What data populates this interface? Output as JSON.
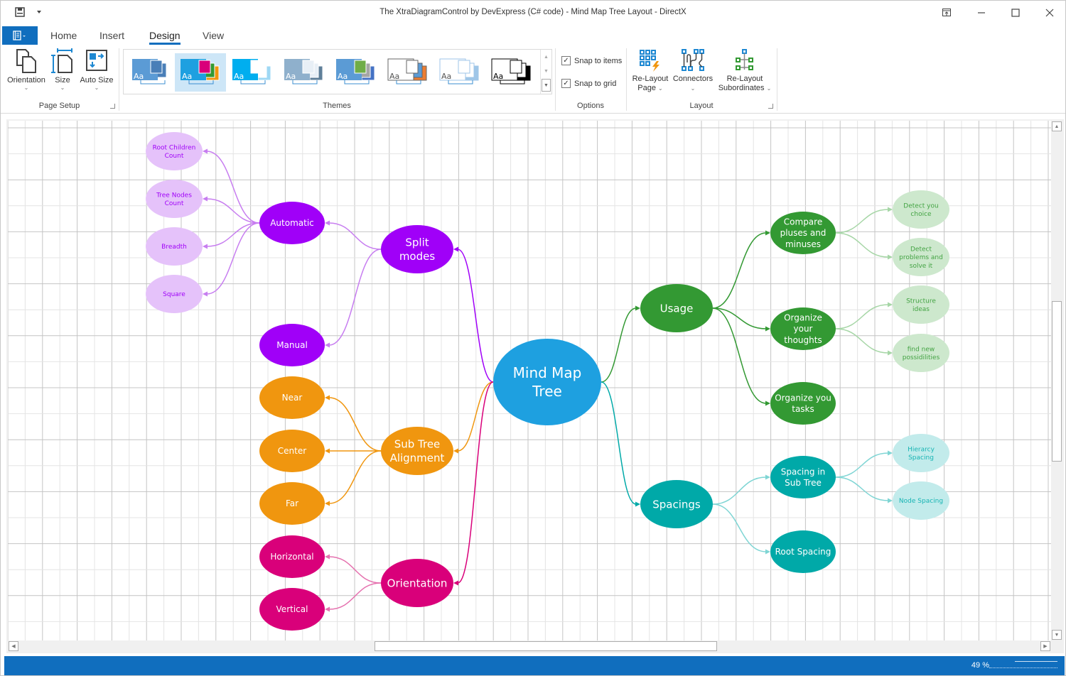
{
  "window": {
    "title": "The XtraDiagramControl by DevExpress (C# code) - Mind Map Tree Layout - DirectX",
    "controls": [
      "restore-ribbon",
      "minimize",
      "maximize",
      "close"
    ]
  },
  "ribbon": {
    "tabs": [
      {
        "label": "Home",
        "active": false
      },
      {
        "label": "Insert",
        "active": false
      },
      {
        "label": "Design",
        "active": true
      },
      {
        "label": "View",
        "active": false
      }
    ],
    "groups": {
      "page_setup": {
        "label": "Page Setup",
        "buttons": [
          {
            "label": "Orientation",
            "icon": "orientation-icon",
            "dropdown": true
          },
          {
            "label": "Size",
            "icon": "page-size-icon",
            "dropdown": true
          },
          {
            "label": "Auto Size",
            "icon": "auto-size-icon",
            "dropdown": true
          }
        ]
      },
      "themes": {
        "label": "Themes",
        "items": [
          {
            "name": "theme-office",
            "selected": false,
            "colors": [
              "#5b9bd5",
              "#4a7fb8",
              "#ffffff"
            ]
          },
          {
            "name": "theme-colorful",
            "selected": true,
            "colors": [
              "#1ea0e0",
              "#d9007a",
              "#339933",
              "#f0960f"
            ]
          },
          {
            "name": "theme-blue",
            "selected": false,
            "colors": [
              "#00aeef",
              "#ffffff",
              "#9fd8f4"
            ]
          },
          {
            "name": "theme-gray",
            "selected": false,
            "colors": [
              "#8fb0cc",
              "#e8eff6",
              "#5f7f99"
            ]
          },
          {
            "name": "theme-green",
            "selected": false,
            "colors": [
              "#5b9bd5",
              "#70ad47",
              "#a5a5a5",
              "#4472c4"
            ]
          },
          {
            "name": "theme-orange",
            "selected": false,
            "colors": [
              "#ffffff",
              "#ffffff",
              "#5b9bd5",
              "#ed7d31"
            ]
          },
          {
            "name": "theme-outline-blue",
            "selected": false,
            "colors": [
              "#ffffff",
              "#ffffff",
              "#9fc6e8"
            ]
          },
          {
            "name": "theme-black-white",
            "selected": false,
            "colors": [
              "#ffffff",
              "#ffffff",
              "#000000"
            ]
          }
        ]
      },
      "options": {
        "label": "Options",
        "checkboxes": [
          {
            "label": "Snap to items",
            "checked": true
          },
          {
            "label": "Snap to grid",
            "checked": true
          }
        ]
      },
      "layout": {
        "label": "Layout",
        "buttons": [
          {
            "label_line1": "Re-Layout",
            "label_line2": "Page",
            "icon": "relayout-page-icon",
            "dropdown": true
          },
          {
            "label_line1": "Connectors",
            "label_line2": "",
            "icon": "connectors-icon",
            "dropdown": true
          },
          {
            "label_line1": "Re-Layout",
            "label_line2": "Subordinates",
            "icon": "relayout-subordinates-icon",
            "dropdown": true
          }
        ]
      }
    }
  },
  "diagram": {
    "colors": {
      "root": "#1ea0e0",
      "purple": "#a000f8",
      "purple_light": "#e5c2fa",
      "purple_conn": "#c77df0",
      "purple_text": "#a000f8",
      "orange": "#f0960f",
      "magenta": "#d9007a",
      "magenta_conn": "#e570ae",
      "green": "#339933",
      "green_light": "#cde8cd",
      "green_conn": "#a6d6a6",
      "green_text": "#43a343",
      "teal": "#00a9a8",
      "teal_light": "#c2ebeb",
      "teal_conn": "#7fd5d4",
      "teal_text": "#16b4b3"
    },
    "nodes": [
      {
        "id": "root",
        "label": "Mind Map Tree",
        "style": "root"
      },
      {
        "id": "split",
        "label": "Split modes",
        "style": "purple",
        "parent": "root"
      },
      {
        "id": "automatic",
        "label": "Automatic",
        "style": "purple",
        "parent": "split"
      },
      {
        "id": "rcc",
        "label": "Root Children Count",
        "style": "purple_light",
        "parent": "automatic"
      },
      {
        "id": "tnc",
        "label": "Tree Nodes Count",
        "style": "purple_light",
        "parent": "automatic"
      },
      {
        "id": "breadth",
        "label": "Breadth",
        "style": "purple_light",
        "parent": "automatic"
      },
      {
        "id": "square",
        "label": "Square",
        "style": "purple_light",
        "parent": "automatic"
      },
      {
        "id": "manual",
        "label": "Manual",
        "style": "purple",
        "parent": "split"
      },
      {
        "id": "subtree",
        "label": "Sub Tree Alignment",
        "style": "orange",
        "parent": "root"
      },
      {
        "id": "near",
        "label": "Near",
        "style": "orange",
        "parent": "subtree"
      },
      {
        "id": "center",
        "label": "Center",
        "style": "orange",
        "parent": "subtree"
      },
      {
        "id": "far",
        "label": "Far",
        "style": "orange",
        "parent": "subtree"
      },
      {
        "id": "orientation",
        "label": "Orientation",
        "style": "magenta",
        "parent": "root"
      },
      {
        "id": "horizontal",
        "label": "Horizontal",
        "style": "magenta",
        "parent": "orientation"
      },
      {
        "id": "vertical",
        "label": "Vertical",
        "style": "magenta",
        "parent": "orientation"
      },
      {
        "id": "usage",
        "label": "Usage",
        "style": "green",
        "parent": "root"
      },
      {
        "id": "compare",
        "label": "Compare pluses and minuses",
        "style": "green",
        "parent": "usage"
      },
      {
        "id": "detectchoice",
        "label": "Detect you choice",
        "style": "green_light",
        "parent": "compare"
      },
      {
        "id": "detectproblems",
        "label": "Detect problems and solve it",
        "style": "green_light",
        "parent": "compare"
      },
      {
        "id": "organizethoughts",
        "label": "Organize your thoughts",
        "style": "green",
        "parent": "usage"
      },
      {
        "id": "structure",
        "label": "Structure ideas",
        "style": "green_light",
        "parent": "organizethoughts"
      },
      {
        "id": "findnew",
        "label": "find new possidilities",
        "style": "green_light",
        "parent": "organizethoughts"
      },
      {
        "id": "organizetasks",
        "label": "Organize you tasks",
        "style": "green",
        "parent": "usage"
      },
      {
        "id": "spacings",
        "label": "Spacings",
        "style": "teal",
        "parent": "root"
      },
      {
        "id": "spacingsub",
        "label": "Spacing in Sub Tree",
        "style": "teal",
        "parent": "spacings"
      },
      {
        "id": "hierarcy",
        "label": "Hierarcy Spacing",
        "style": "teal_light",
        "parent": "spacingsub"
      },
      {
        "id": "nodespacing",
        "label": "Node Spacing",
        "style": "teal_light",
        "parent": "spacingsub"
      },
      {
        "id": "rootspacing",
        "label": "Root Spacing",
        "style": "teal",
        "parent": "spacings"
      }
    ]
  },
  "statusbar": {
    "zoom_label": "49 %",
    "zoom_percent": 49
  }
}
